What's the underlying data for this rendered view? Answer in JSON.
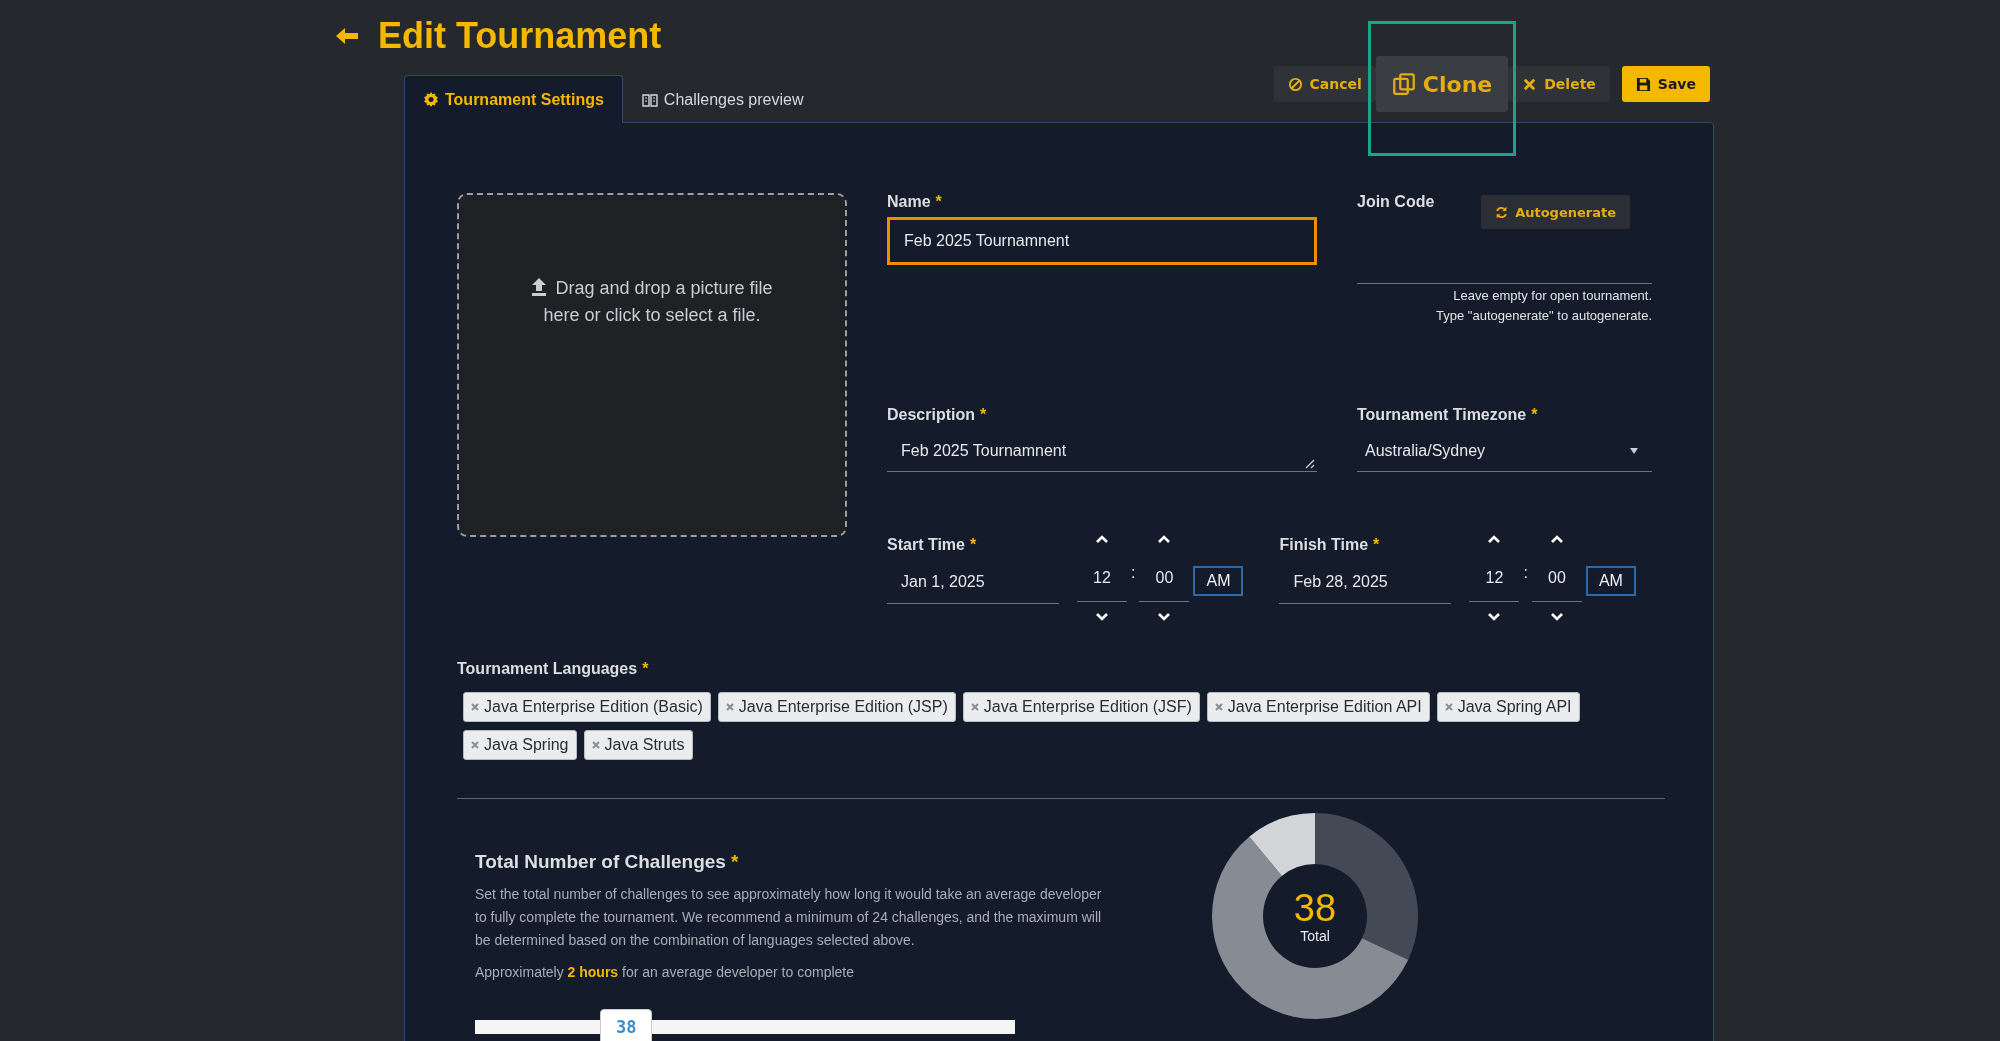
{
  "header": {
    "title": "Edit Tournament"
  },
  "tabs": [
    {
      "label": "Tournament Settings",
      "selected": true
    },
    {
      "label": "Challenges preview",
      "selected": false
    }
  ],
  "actions": [
    {
      "kind": "cancel",
      "label": "Cancel",
      "highlighted": false
    },
    {
      "kind": "clone",
      "label": "Clone",
      "highlighted": true
    },
    {
      "kind": "delete",
      "label": "Delete",
      "highlighted": false
    },
    {
      "kind": "save",
      "label": "Save",
      "highlighted": false
    }
  ],
  "dropzone": {
    "text": "Drag and drop a picture file here or click to select a file."
  },
  "name": {
    "label": "Name",
    "required_mark": "*",
    "value": "Feb 2025 Tournamnent",
    "focused": true
  },
  "join_code": {
    "label": "Join Code",
    "button": "Autogenerate",
    "help": [
      "Leave empty for open tournament.",
      "Type \"autogenerate\" to autogenerate."
    ]
  },
  "description": {
    "label": "Description",
    "required_mark": "*",
    "value": "Feb 2025 Tournamnent"
  },
  "timezone": {
    "label": "Tournament Timezone",
    "required_mark": "*",
    "value": "Australia/Sydney"
  },
  "times": [
    {
      "label": "Start Time",
      "required_mark": "*",
      "date": "Jan 1, 2025",
      "hour": "12",
      "separator": ":",
      "minute": "00",
      "period": "AM"
    },
    {
      "label": "Finish Time",
      "required_mark": "*",
      "date": "Feb 28, 2025",
      "hour": "12",
      "separator": ":",
      "minute": "00",
      "period": "AM"
    }
  ],
  "languages": {
    "label": "Tournament Languages",
    "required_mark": "*",
    "tags": [
      "Java Enterprise Edition (Basic)",
      "Java Enterprise Edition (JSP)",
      "Java Enterprise Edition (JSF)",
      "Java Enterprise Edition API",
      "Java Spring API",
      "Java Spring",
      "Java Struts"
    ]
  },
  "challenges": {
    "title": "Total Number of Challenges",
    "required_mark": "*",
    "description": "Set the total number of challenges to see approximately how long it would take an average developer to fully complete the tournament. We recommend a minimum of 24 challenges, and the maximum will be determined based on the combination of languages selected above.",
    "estimate": "Approximately **2 hours** for an average developer to complete",
    "slider": {
      "level": 0.28,
      "value": "38"
    },
    "donut": {
      "value": "38",
      "caption": "Total"
    }
  }
}
